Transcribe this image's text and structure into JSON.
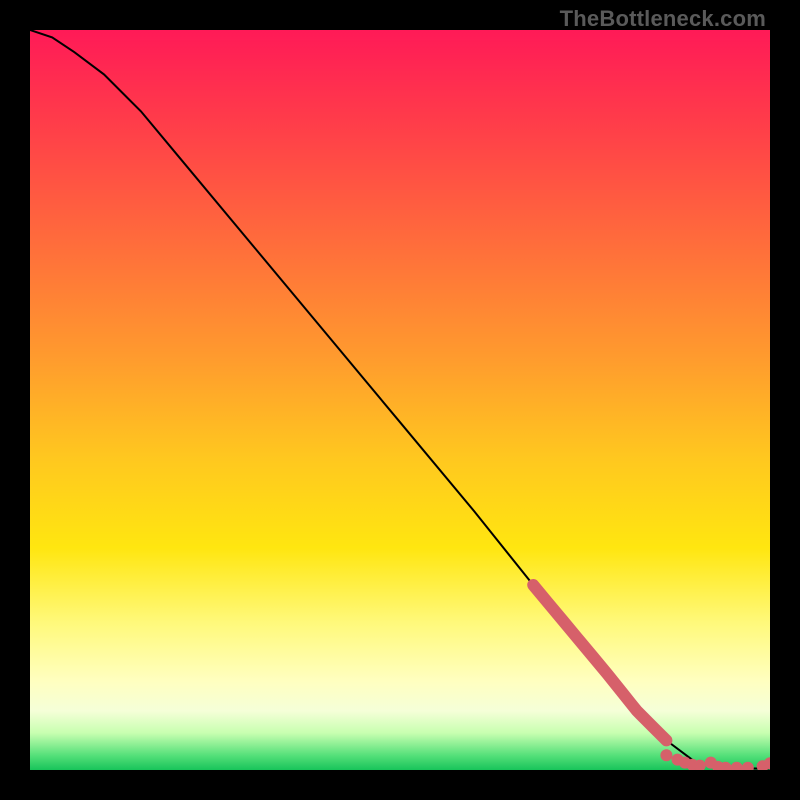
{
  "watermark": {
    "text": "TheBottleneck.com"
  },
  "chart_data": {
    "type": "line",
    "title": "",
    "xlabel": "",
    "ylabel": "",
    "xlim": [
      0,
      100
    ],
    "ylim": [
      0,
      100
    ],
    "grid": false,
    "legend": false,
    "series": [
      {
        "name": "curve",
        "style": "line",
        "color": "#000000",
        "x": [
          0,
          3,
          6,
          10,
          15,
          20,
          30,
          40,
          50,
          60,
          68,
          73,
          78,
          82,
          86,
          90,
          94,
          97,
          100
        ],
        "values": [
          100,
          99,
          97,
          94,
          89,
          83,
          71,
          59,
          47,
          35,
          25,
          19,
          13,
          8,
          4,
          1,
          0.3,
          0.2,
          0.2
        ]
      },
      {
        "name": "highlight-segment",
        "style": "thick-line",
        "color": "#d6606a",
        "x": [
          68,
          70,
          72,
          74,
          76,
          78,
          80,
          82,
          84,
          86
        ],
        "values": [
          25,
          22.6,
          20.2,
          17.8,
          15.4,
          13,
          10.5,
          8,
          6,
          4
        ]
      },
      {
        "name": "tail-dots",
        "style": "dots",
        "color": "#d6606a",
        "x": [
          86,
          87.5,
          88.5,
          89.5,
          90.5,
          92,
          93,
          94,
          95.5,
          97,
          99,
          100
        ],
        "values": [
          2.0,
          1.4,
          1.0,
          0.7,
          0.6,
          1.0,
          0.4,
          0.3,
          0.3,
          0.3,
          0.5,
          0.9
        ]
      }
    ]
  }
}
